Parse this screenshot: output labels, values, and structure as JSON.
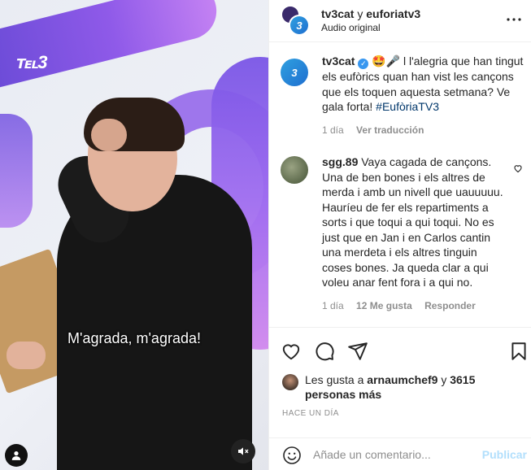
{
  "video": {
    "subtitle": "M'agrada, m'agrada!",
    "watermark": "℡3"
  },
  "header": {
    "user1": "tv3cat",
    "separator": " y ",
    "user2": "euforiatv3",
    "audio": "Audio original",
    "more_icon": "more-horizontal-icon"
  },
  "caption": {
    "user": "tv3cat",
    "text_a": " 🤩🎤 l l'alegria que han tingut els eufòrics quan han vist les cançons que els toquen aquesta setmana? Ve gala forta! ",
    "hashtag": "#EufòriaTV3",
    "time": "1 día",
    "translate": "Ver traducción"
  },
  "comment": {
    "user": "sgg.89",
    "text": " Vaya cagada de cançons. Una de ben bones i els altres de merda i amb un nivell que uauuuuu. Hauríeu de fer els repartiments a sorts i que toqui a qui toqui. No es just que en Jan i en Carlos cantin una merdeta i els altres tinguin coses bones. Ja queda clar a qui voleu anar fent fora i a qui no.",
    "time": "1 día",
    "likes": "12 Me gusta",
    "reply": "Responder"
  },
  "likes": {
    "prefix": "Les gusta a ",
    "user": "arnaumchef9",
    "middle": " y ",
    "count": "3615",
    "suffix": "personas más"
  },
  "timestamp": "HACE UN DÍA",
  "composer": {
    "placeholder": "Añade un comentario...",
    "publish": "Publicar"
  },
  "colors": {
    "link": "#00376b",
    "muted": "#8e8e8e",
    "publish_disabled": "#b2dffc",
    "verified": "#3897f0"
  }
}
